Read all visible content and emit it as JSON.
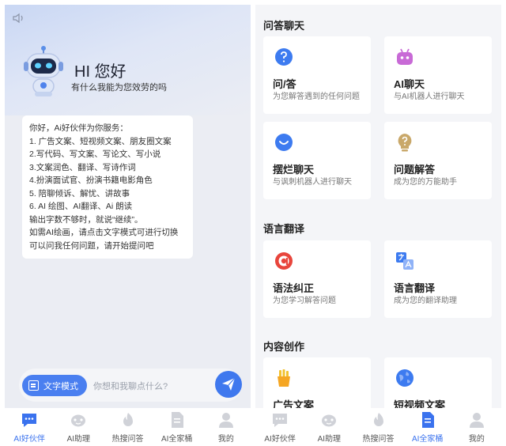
{
  "left": {
    "greeting": "HI 您好",
    "greeting_sub": "有什么我能为您效劳的吗",
    "intro_lines": [
      "你好，Ai好伙伴为你服务：",
      "1. 广告文案、短视频文案、朋友圈文案",
      "2.写代码、写文案、写论文、写小说",
      "3.文案润色、翻译、写诗作词",
      "4.扮演面试官、扮演书籍电影角色",
      "5. 陪聊倾诉、解忧、讲故事",
      "6. AI 绘图、AI翻译、Ai 朗读",
      "输出字数不够时，就说“继续”。",
      "如需AI绘画，请点击文字模式可进行切换",
      "可以问我任何问题，请开始提问吧"
    ],
    "mode_button": "文字模式",
    "input_placeholder": "你想和我聊点什么?",
    "tabs": [
      {
        "label": "AI好伙伴",
        "icon": "chat-bubble-icon",
        "active": true
      },
      {
        "label": "AI助理",
        "icon": "robot-face-icon",
        "active": false
      },
      {
        "label": "热搜问答",
        "icon": "flame-icon",
        "active": false
      },
      {
        "label": "AI全家桶",
        "icon": "document-icon",
        "active": false
      },
      {
        "label": "我的",
        "icon": "person-icon",
        "active": false
      }
    ]
  },
  "right": {
    "sections": [
      {
        "title": "问答聊天",
        "cards": [
          {
            "title": "问/答",
            "desc": "为您解答遇到的任何问题",
            "icon": "question-circle-icon",
            "color": "#3d7bf0"
          },
          {
            "title": "AI聊天",
            "desc": "与AI机器人进行聊天",
            "icon": "robot-icon",
            "color": "#c86ad6"
          },
          {
            "title": "摆烂聊天",
            "desc": "与讽刺机器人进行聊天",
            "icon": "smile-circle-icon",
            "color": "#3d7bf0"
          },
          {
            "title": "问题解答",
            "desc": "成为您的万能助手",
            "icon": "lightbulb-question-icon",
            "color": "#c9a86a"
          }
        ]
      },
      {
        "title": "语言翻译",
        "cards": [
          {
            "title": "语法纠正",
            "desc": "为您学习解答问题",
            "icon": "letter-a-circle-icon",
            "color": "#e8453c"
          },
          {
            "title": "语言翻译",
            "desc": "成为您的翻译助理",
            "icon": "translate-icon",
            "color": "#3d7bf0"
          }
        ]
      },
      {
        "title": "内容创作",
        "cards": [
          {
            "title": "广告文案",
            "desc": "",
            "icon": "fries-icon",
            "color": "#f2c230"
          },
          {
            "title": "短视频文案",
            "desc": "",
            "icon": "globe-icon",
            "color": "#3d7bf0"
          }
        ]
      }
    ],
    "tabs": [
      {
        "label": "AI好伙伴",
        "icon": "chat-bubble-icon",
        "active": false
      },
      {
        "label": "AI助理",
        "icon": "robot-face-icon",
        "active": false
      },
      {
        "label": "热搜问答",
        "icon": "flame-icon",
        "active": false
      },
      {
        "label": "AI全家桶",
        "icon": "document-icon",
        "active": true
      },
      {
        "label": "我的",
        "icon": "person-icon",
        "active": false
      }
    ]
  },
  "colors": {
    "accent": "#3a72ee",
    "inactive_icon": "#d0d2d8"
  }
}
